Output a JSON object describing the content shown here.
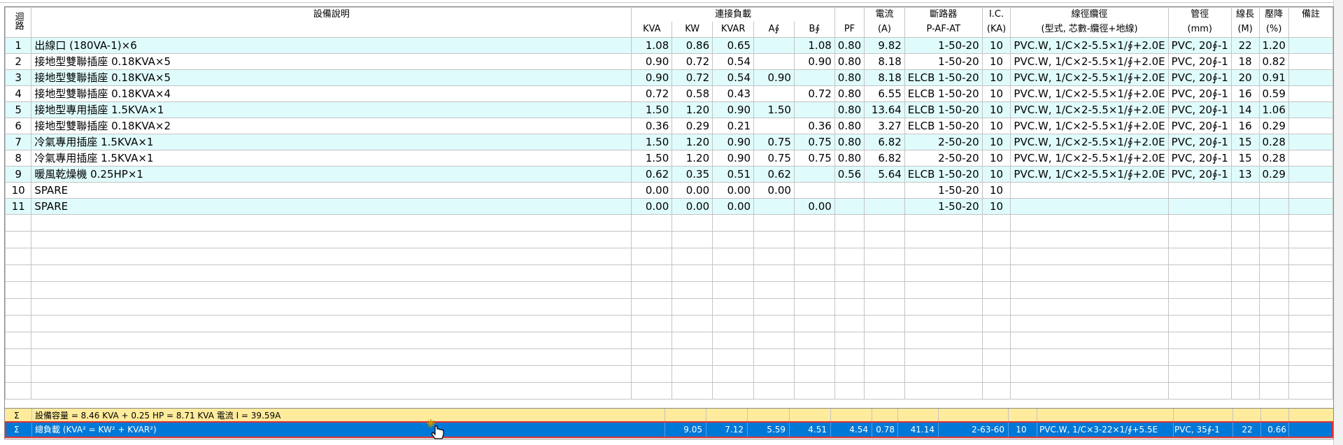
{
  "header": {
    "circuit": "迴路",
    "description": "設備說明",
    "connected_load": "連接負載",
    "current_top": "電流",
    "breaker_top": "斷路器",
    "ic_top": "I.C.",
    "wire_top": "線徑纜徑",
    "conduit_top": "管徑",
    "length_top": "線長",
    "drop_top": "壓降",
    "remark": "備註",
    "kva": "KVA",
    "kw": "KW",
    "kvar": "KVAR",
    "a_phase": "A∮",
    "b_phase": "B∮",
    "pf": "PF",
    "current_unit": "(A)",
    "breaker_sub": "P-AF-AT",
    "ic_unit": "(KA)",
    "wire_sub": "(型式, 芯數-纜徑+地線)",
    "conduit_unit": "(mm)",
    "length_unit": "(M)",
    "drop_unit": "(%)"
  },
  "rows": [
    {
      "no": "1",
      "desc": "出線口 (180VA-1)×6",
      "kva": "1.08",
      "kw": "0.86",
      "kvar": "0.65",
      "a": "",
      "b": "1.08",
      "pf": "0.80",
      "amp": "9.82",
      "breaker": "1-50-20",
      "ic": "10",
      "wire": "PVC.W, 1/C×2-5.5×1/∮+2.0E",
      "conduit": "PVC, 20∮-1",
      "len": "22",
      "drop": "1.20",
      "remark": ""
    },
    {
      "no": "2",
      "desc": "接地型雙聯插座 0.18KVA×5",
      "kva": "0.90",
      "kw": "0.72",
      "kvar": "0.54",
      "a": "",
      "b": "0.90",
      "pf": "0.80",
      "amp": "8.18",
      "breaker": "1-50-20",
      "ic": "10",
      "wire": "PVC.W, 1/C×2-5.5×1/∮+2.0E",
      "conduit": "PVC, 20∮-1",
      "len": "18",
      "drop": "0.82",
      "remark": ""
    },
    {
      "no": "3",
      "desc": "接地型雙聯插座 0.18KVA×5",
      "kva": "0.90",
      "kw": "0.72",
      "kvar": "0.54",
      "a": "0.90",
      "b": "",
      "pf": "0.80",
      "amp": "8.18",
      "breaker": "ELCB 1-50-20",
      "ic": "10",
      "wire": "PVC.W, 1/C×2-5.5×1/∮+2.0E",
      "conduit": "PVC, 20∮-1",
      "len": "20",
      "drop": "0.91",
      "remark": ""
    },
    {
      "no": "4",
      "desc": "接地型雙聯插座 0.18KVA×4",
      "kva": "0.72",
      "kw": "0.58",
      "kvar": "0.43",
      "a": "",
      "b": "0.72",
      "pf": "0.80",
      "amp": "6.55",
      "breaker": "ELCB 1-50-20",
      "ic": "10",
      "wire": "PVC.W, 1/C×2-5.5×1/∮+2.0E",
      "conduit": "PVC, 20∮-1",
      "len": "16",
      "drop": "0.59",
      "remark": ""
    },
    {
      "no": "5",
      "desc": "接地型專用插座 1.5KVA×1",
      "kva": "1.50",
      "kw": "1.20",
      "kvar": "0.90",
      "a": "1.50",
      "b": "",
      "pf": "0.80",
      "amp": "13.64",
      "breaker": "ELCB 1-50-20",
      "ic": "10",
      "wire": "PVC.W, 1/C×2-5.5×1/∮+2.0E",
      "conduit": "PVC, 20∮-1",
      "len": "14",
      "drop": "1.06",
      "remark": ""
    },
    {
      "no": "6",
      "desc": "接地型雙聯插座 0.18KVA×2",
      "kva": "0.36",
      "kw": "0.29",
      "kvar": "0.21",
      "a": "",
      "b": "0.36",
      "pf": "0.80",
      "amp": "3.27",
      "breaker": "ELCB 1-50-20",
      "ic": "10",
      "wire": "PVC.W, 1/C×2-5.5×1/∮+2.0E",
      "conduit": "PVC, 20∮-1",
      "len": "16",
      "drop": "0.29",
      "remark": ""
    },
    {
      "no": "7",
      "desc": "冷氣專用插座 1.5KVA×1",
      "kva": "1.50",
      "kw": "1.20",
      "kvar": "0.90",
      "a": "0.75",
      "b": "0.75",
      "pf": "0.80",
      "amp": "6.82",
      "breaker": "2-50-20",
      "ic": "10",
      "wire": "PVC.W, 1/C×2-5.5×1/∮+2.0E",
      "conduit": "PVC, 20∮-1",
      "len": "15",
      "drop": "0.28",
      "remark": ""
    },
    {
      "no": "8",
      "desc": "冷氣專用插座 1.5KVA×1",
      "kva": "1.50",
      "kw": "1.20",
      "kvar": "0.90",
      "a": "0.75",
      "b": "0.75",
      "pf": "0.80",
      "amp": "6.82",
      "breaker": "2-50-20",
      "ic": "10",
      "wire": "PVC.W, 1/C×2-5.5×1/∮+2.0E",
      "conduit": "PVC, 20∮-1",
      "len": "15",
      "drop": "0.28",
      "remark": ""
    },
    {
      "no": "9",
      "desc": "暖風乾燥機 0.25HP×1",
      "kva": "0.62",
      "kw": "0.35",
      "kvar": "0.51",
      "a": "0.62",
      "b": "",
      "pf": "0.56",
      "amp": "5.64",
      "breaker": "ELCB 1-50-20",
      "ic": "10",
      "wire": "PVC.W, 1/C×2-5.5×1/∮+2.0E",
      "conduit": "PVC, 20∮-1",
      "len": "13",
      "drop": "0.29",
      "remark": ""
    },
    {
      "no": "10",
      "desc": "SPARE",
      "kva": "0.00",
      "kw": "0.00",
      "kvar": "0.00",
      "a": "0.00",
      "b": "",
      "pf": "",
      "amp": "",
      "breaker": "1-50-20",
      "ic": "10",
      "wire": "",
      "conduit": "",
      "len": "",
      "drop": "",
      "remark": ""
    },
    {
      "no": "11",
      "desc": "SPARE",
      "kva": "0.00",
      "kw": "0.00",
      "kvar": "0.00",
      "a": "",
      "b": "0.00",
      "pf": "",
      "amp": "",
      "breaker": "1-50-20",
      "ic": "10",
      "wire": "",
      "conduit": "",
      "len": "",
      "drop": "",
      "remark": ""
    }
  ],
  "summary_capacity": {
    "sigma": "Σ",
    "text": "設備容量 = 8.46 KVA + 0.25 HP = 8.71 KVA 電流 I = 39.59A"
  },
  "summary_total": {
    "sigma": "Σ",
    "label": "總負載 (KVA² = KW² + KVAR²)",
    "kva": "9.05",
    "kw": "7.12",
    "kvar": "5.59",
    "a": "4.51",
    "b": "4.54",
    "pf": "0.78",
    "amp": "41.14",
    "breaker": "2-63-60",
    "ic": "10",
    "wire": "PVC.W, 1/C×3-22×1/∮+5.5E",
    "conduit": "PVC, 35∮-1",
    "len": "22",
    "drop": "0.66"
  },
  "colors": {
    "row_cyan": "#e0fbfb",
    "summary_yellow": "#ffeb9c",
    "selected_blue": "#0078d7",
    "selection_border": "#e03030"
  },
  "icons": [
    "hand-pointer-cursor-icon"
  ]
}
